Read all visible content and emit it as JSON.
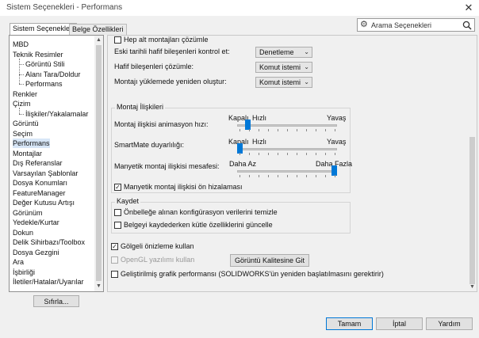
{
  "window": {
    "title": "Sistem Seçenekleri - Performans",
    "close_glyph": "✕"
  },
  "tabs": [
    {
      "label": "Sistem Seçenekleri",
      "active": true
    },
    {
      "label": "Belge Özellikleri",
      "active": false
    }
  ],
  "search": {
    "label": "Arama Seçenekleri",
    "gear_icon": "gear-icon",
    "search_icon": "magnifier-icon"
  },
  "tree": {
    "items": [
      {
        "label": "MBD",
        "indent": 0,
        "selected": false
      },
      {
        "label": "Teknik Resimler",
        "indent": 0,
        "selected": false
      },
      {
        "label": "Görüntü Stili",
        "indent": 1,
        "selected": false
      },
      {
        "label": "Alanı Tara/Doldur",
        "indent": 1,
        "selected": false
      },
      {
        "label": "Performans",
        "indent": 1,
        "selected": false
      },
      {
        "label": "Renkler",
        "indent": 0,
        "selected": false
      },
      {
        "label": "Çizim",
        "indent": 0,
        "selected": false
      },
      {
        "label": "İlişkiler/Yakalamalar",
        "indent": 1,
        "selected": false
      },
      {
        "label": "Görüntü",
        "indent": 0,
        "selected": false
      },
      {
        "label": "Seçim",
        "indent": 0,
        "selected": false
      },
      {
        "label": "Performans",
        "indent": 0,
        "selected": true
      },
      {
        "label": "Montajlar",
        "indent": 0,
        "selected": false
      },
      {
        "label": "Dış Referanslar",
        "indent": 0,
        "selected": false
      },
      {
        "label": "Varsayılan Şablonlar",
        "indent": 0,
        "selected": false
      },
      {
        "label": "Dosya Konumları",
        "indent": 0,
        "selected": false
      },
      {
        "label": "FeatureManager",
        "indent": 0,
        "selected": false
      },
      {
        "label": "Değer Kutusu Artışı",
        "indent": 0,
        "selected": false
      },
      {
        "label": "Görünüm",
        "indent": 0,
        "selected": false
      },
      {
        "label": "Yedekle/Kurtar",
        "indent": 0,
        "selected": false
      },
      {
        "label": "Dokun",
        "indent": 0,
        "selected": false
      },
      {
        "label": "Delik Sihirbazı/Toolbox",
        "indent": 0,
        "selected": false
      },
      {
        "label": "Dosya Gezgini",
        "indent": 0,
        "selected": false
      },
      {
        "label": "Ara",
        "indent": 0,
        "selected": false
      },
      {
        "label": "İşbirliği",
        "indent": 0,
        "selected": false
      },
      {
        "label": "İletiler/Hatalar/Uyarılar",
        "indent": 0,
        "selected": false
      }
    ]
  },
  "reset_button": "Sıfırla...",
  "top_section": {
    "cut_label": "Hep alt montajları çözümle",
    "rows": [
      {
        "label": "Eski tarihli hafif bileşenleri kontrol et:",
        "value": "Denetleme"
      },
      {
        "label": "Hafif bileşenleri çözümle:",
        "value": "Komut istemi"
      },
      {
        "label": "Montajı yüklemede yeniden oluştur:",
        "value": "Komut istemi"
      }
    ]
  },
  "mates": {
    "title": "Montaj İlişkileri",
    "sliders": [
      {
        "label": "Montaj ilişkisi animasyon hızı:",
        "left": "Kapalı",
        "mid": "Hızlı",
        "right": "Yavaş",
        "value_fraction": 0.08
      },
      {
        "label": "SmartMate duyarlılığı:",
        "left": "Kapalı",
        "mid": "Hızlı",
        "right": "Yavaş",
        "value_fraction": 0.0
      },
      {
        "label": "Manyetik montaj ilişkisi mesafesi:",
        "left": "Daha Az",
        "right": "Daha Fazla",
        "value_fraction": 1.0
      }
    ],
    "magnetic_checkbox": {
      "label": "Manyetik montaj ilişkisi ön hizalaması",
      "checked": true
    }
  },
  "save": {
    "title": "Kaydet",
    "items": [
      {
        "label": "Önbelleğe alınan konfigürasyon verilerini temizle",
        "checked": false
      },
      {
        "label": "Belgeyi kaydederken kütle özelliklerini güncelle",
        "checked": false
      }
    ]
  },
  "display": {
    "shaded_preview": {
      "label": "Gölgeli önizleme kullan",
      "checked": true
    },
    "opengl": {
      "label": "OpenGL yazılımı kullan",
      "checked": false,
      "disabled": true
    },
    "image_quality_button": "Görüntü Kalitesine Git",
    "enhanced_graphics": {
      "label": "Geliştirilmiş grafik performansı (SOLIDWORKS'ün yeniden başlatılmasını gerektirir)",
      "checked": false
    }
  },
  "footer": {
    "ok": "Tamam",
    "cancel": "İptal",
    "help": "Yardım"
  },
  "colors": {
    "accent": "#0078d7",
    "selection": "#d7e6f7",
    "window_bg": "#f0f0f0"
  }
}
